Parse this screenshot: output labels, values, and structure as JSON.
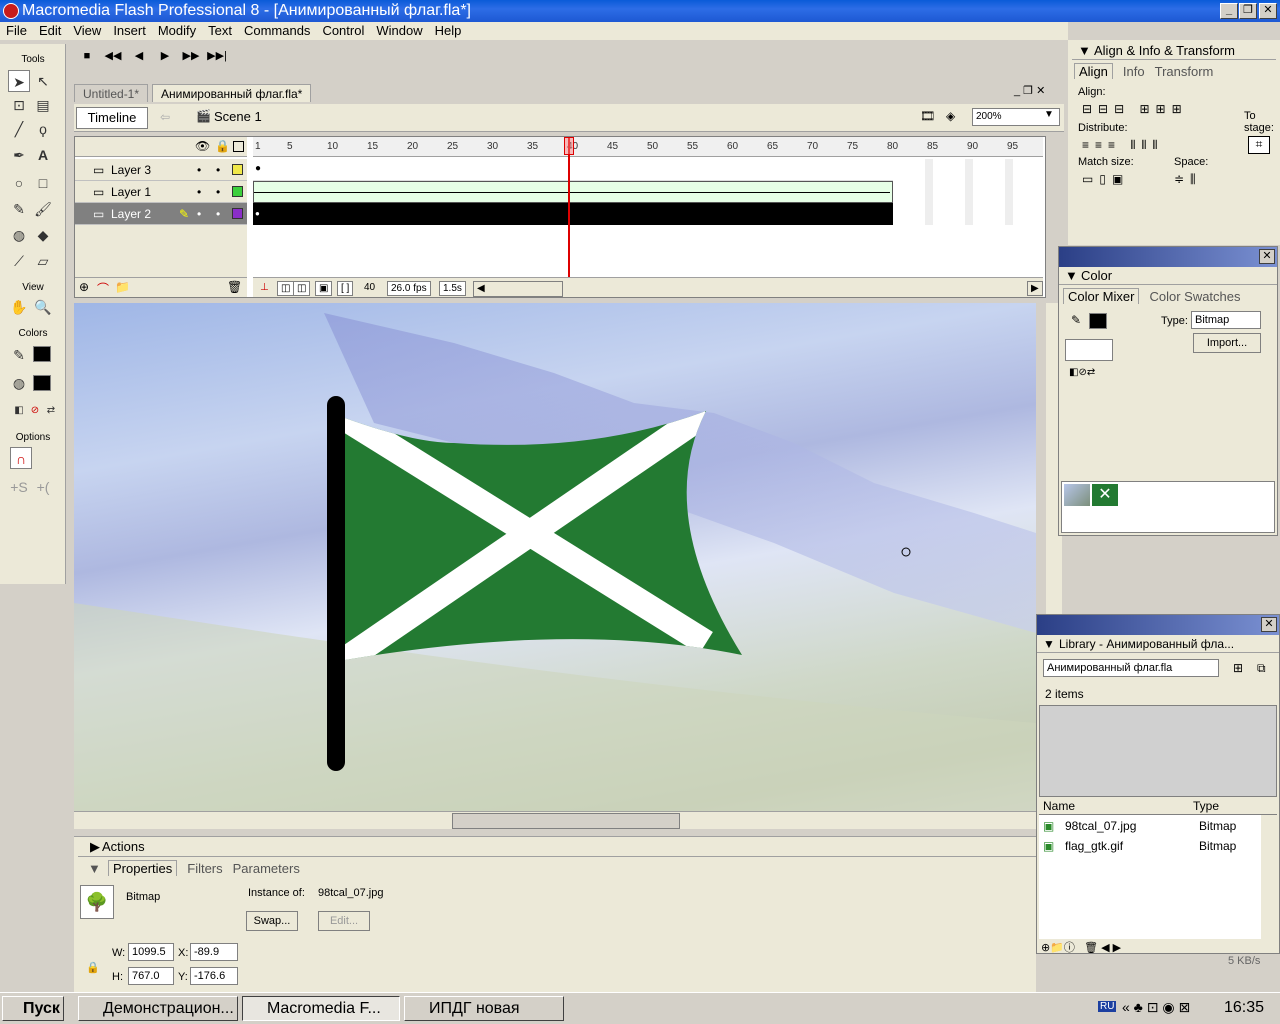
{
  "window": {
    "title": "Macromedia Flash Professional 8 - [Анимированный флаг.fla*]"
  },
  "menu": [
    "File",
    "Edit",
    "View",
    "Insert",
    "Modify",
    "Text",
    "Commands",
    "Control",
    "Window",
    "Help"
  ],
  "tools": {
    "label": "Tools",
    "view_label": "View",
    "colors_label": "Colors",
    "options_label": "Options"
  },
  "controller": [
    "■",
    "◀◀",
    "◀",
    "▶",
    "▶▶",
    "▶▶|"
  ],
  "doc_tabs": [
    "Untitled-1*",
    "Анимированный флаг.fla*"
  ],
  "editbar": {
    "timeline": "Timeline",
    "scene": "Scene 1",
    "zoom": "200%"
  },
  "timeline": {
    "layers": [
      {
        "name": "Layer 3",
        "color": "#f0e84a",
        "selected": false
      },
      {
        "name": "Layer 1",
        "color": "#3ccf3c",
        "selected": false
      },
      {
        "name": "Layer 2",
        "color": "#8a2ec8",
        "selected": true
      }
    ],
    "ruler": [
      "1",
      "5",
      "10",
      "15",
      "20",
      "25",
      "30",
      "35",
      "40",
      "45",
      "50",
      "55",
      "60",
      "65",
      "70",
      "75",
      "80",
      "85",
      "90",
      "95"
    ],
    "current_frame": "40",
    "fps": "26.0 fps",
    "time": "1.5s"
  },
  "align": {
    "title": "Align & Info & Transform",
    "tabs": [
      "Align",
      "Info",
      "Transform"
    ],
    "align": "Align:",
    "distribute": "Distribute:",
    "match": "Match size:",
    "space": "Space:",
    "to_stage": "To stage:"
  },
  "color": {
    "title": "Color",
    "tabs": [
      "Color Mixer",
      "Color Swatches"
    ],
    "type_label": "Type:",
    "type_value": "Bitmap",
    "import": "Import..."
  },
  "library": {
    "title": "Library - Анимированный фла...",
    "doc": "Анимированный флаг.fla",
    "count": "2 items",
    "col_name": "Name",
    "col_type": "Type",
    "items": [
      {
        "name": "98tcal_07.jpg",
        "type": "Bitmap"
      },
      {
        "name": "flag_gtk.gif",
        "type": "Bitmap"
      }
    ]
  },
  "actions": {
    "label": "Actions"
  },
  "properties": {
    "tabs": [
      "Properties",
      "Filters",
      "Parameters"
    ],
    "kind": "Bitmap",
    "instance_label": "Instance of:",
    "instance": "98tcal_07.jpg",
    "swap": "Swap...",
    "edit": "Edit...",
    "w": "1099.5",
    "h": "767.0",
    "x": "-89.9",
    "y": "-176.6"
  },
  "taskbar": {
    "start": "Пуск",
    "tasks": [
      "Демонстрацион...",
      "Macromedia F...",
      "ИПДГ новая"
    ],
    "lang": "RU",
    "clock": "16:35",
    "net": "5 KB/s"
  },
  "flag": {
    "green": "#237a32",
    "pole": "#000000"
  }
}
